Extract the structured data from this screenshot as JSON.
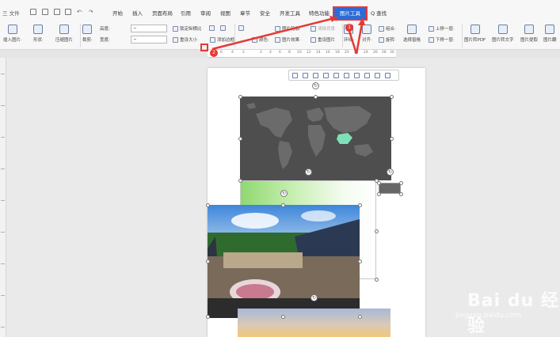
{
  "quick_access": {
    "menu_label": "三 文件",
    "undo_label": "↶·",
    "redo_label": "↷"
  },
  "menu_tabs": [
    "开始",
    "插入",
    "页面布局",
    "引用",
    "审阅",
    "视图",
    "章节",
    "安全",
    "开发工具",
    "特色功能"
  ],
  "active_tab": "图片工具",
  "search_label": "Q 查找",
  "ribbon": {
    "insert_picture": "插入图片·",
    "shape": "形状·",
    "compress": "压缩图片",
    "crop": "裁剪·",
    "height_label": "高度:",
    "width_label": "宽度:",
    "height_value": "−",
    "width_value": "−",
    "lock_ratio": "锁定纵横比",
    "reset_size": "重设大小",
    "add_border": "添加边框·",
    "color": "颜色·",
    "picture_outline": "图片轮廓·",
    "picture_effect": "图片效果·",
    "reset_picture": "重设图片",
    "clear_background": "清除背景",
    "wrap": "环绕·",
    "align": "对齐·",
    "combine": "组合·",
    "rotate": "旋转·",
    "select_pane": "选择窗格",
    "bring_forward": "上移一层·",
    "send_backward": "下移一层·",
    "pic_to_pdf": "图片转PDF",
    "pic_to_text": "图片转文字",
    "pic_extract": "图片提取",
    "pic_more": "图片翻"
  },
  "ruler_ticks": [
    "6",
    "4",
    "2",
    "2",
    "4",
    "6",
    "8",
    "10",
    "12",
    "14",
    "16",
    "18",
    "20",
    "22",
    "24",
    "26",
    "28",
    "30"
  ],
  "annotations": {
    "step1": "1",
    "step2": "2"
  },
  "watermark": {
    "brand": "Bai du 经验",
    "url": "jingyan.baidu.com"
  },
  "colors": {
    "accent": "#2b6cd8",
    "highlight": "#e53935",
    "map_bg": "#4e4e4e",
    "china": "#7fe0b8"
  }
}
